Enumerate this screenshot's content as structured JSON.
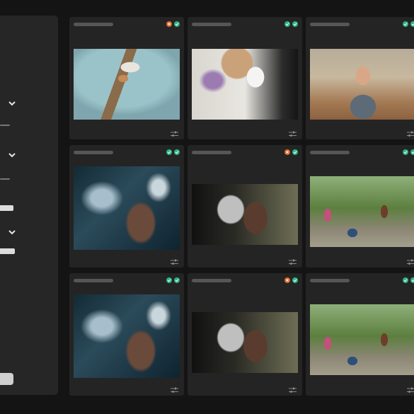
{
  "colors": {
    "background": "#141414",
    "panel": "#262626",
    "card": "#242424",
    "status_orange": "#e06a2b",
    "status_green": "#2fb58a"
  },
  "sidebar": {
    "controls": [
      {
        "type": "dropdown",
        "icon": "chevron-down-icon"
      },
      {
        "type": "slider"
      },
      {
        "type": "dropdown",
        "icon": "chevron-down-icon"
      },
      {
        "type": "slider"
      },
      {
        "type": "toggle-bar"
      },
      {
        "type": "dropdown",
        "icon": "chevron-down-icon"
      },
      {
        "type": "toggle-bar"
      }
    ],
    "action_button": {
      "icon": "button"
    }
  },
  "grid": {
    "cards": [
      {
        "image": "dog-on-blanket",
        "status": [
          "orange",
          "green"
        ]
      },
      {
        "image": "white-cat-flowers",
        "status": [
          "green",
          "green"
        ]
      },
      {
        "image": "baseball-catcher",
        "status": [
          "green",
          "green"
        ]
      },
      {
        "image": "ocean-aerial",
        "status": [
          "green",
          "green"
        ]
      },
      {
        "image": "elderly-woman",
        "status": [
          "orange",
          "green"
        ]
      },
      {
        "image": "kids-park",
        "status": [
          "green",
          "green"
        ]
      },
      {
        "image": "ocean-aerial",
        "status": [
          "green",
          "green"
        ]
      },
      {
        "image": "elderly-woman",
        "status": [
          "orange",
          "green"
        ]
      },
      {
        "image": "kids-park",
        "status": [
          "green",
          "green"
        ]
      }
    ]
  }
}
